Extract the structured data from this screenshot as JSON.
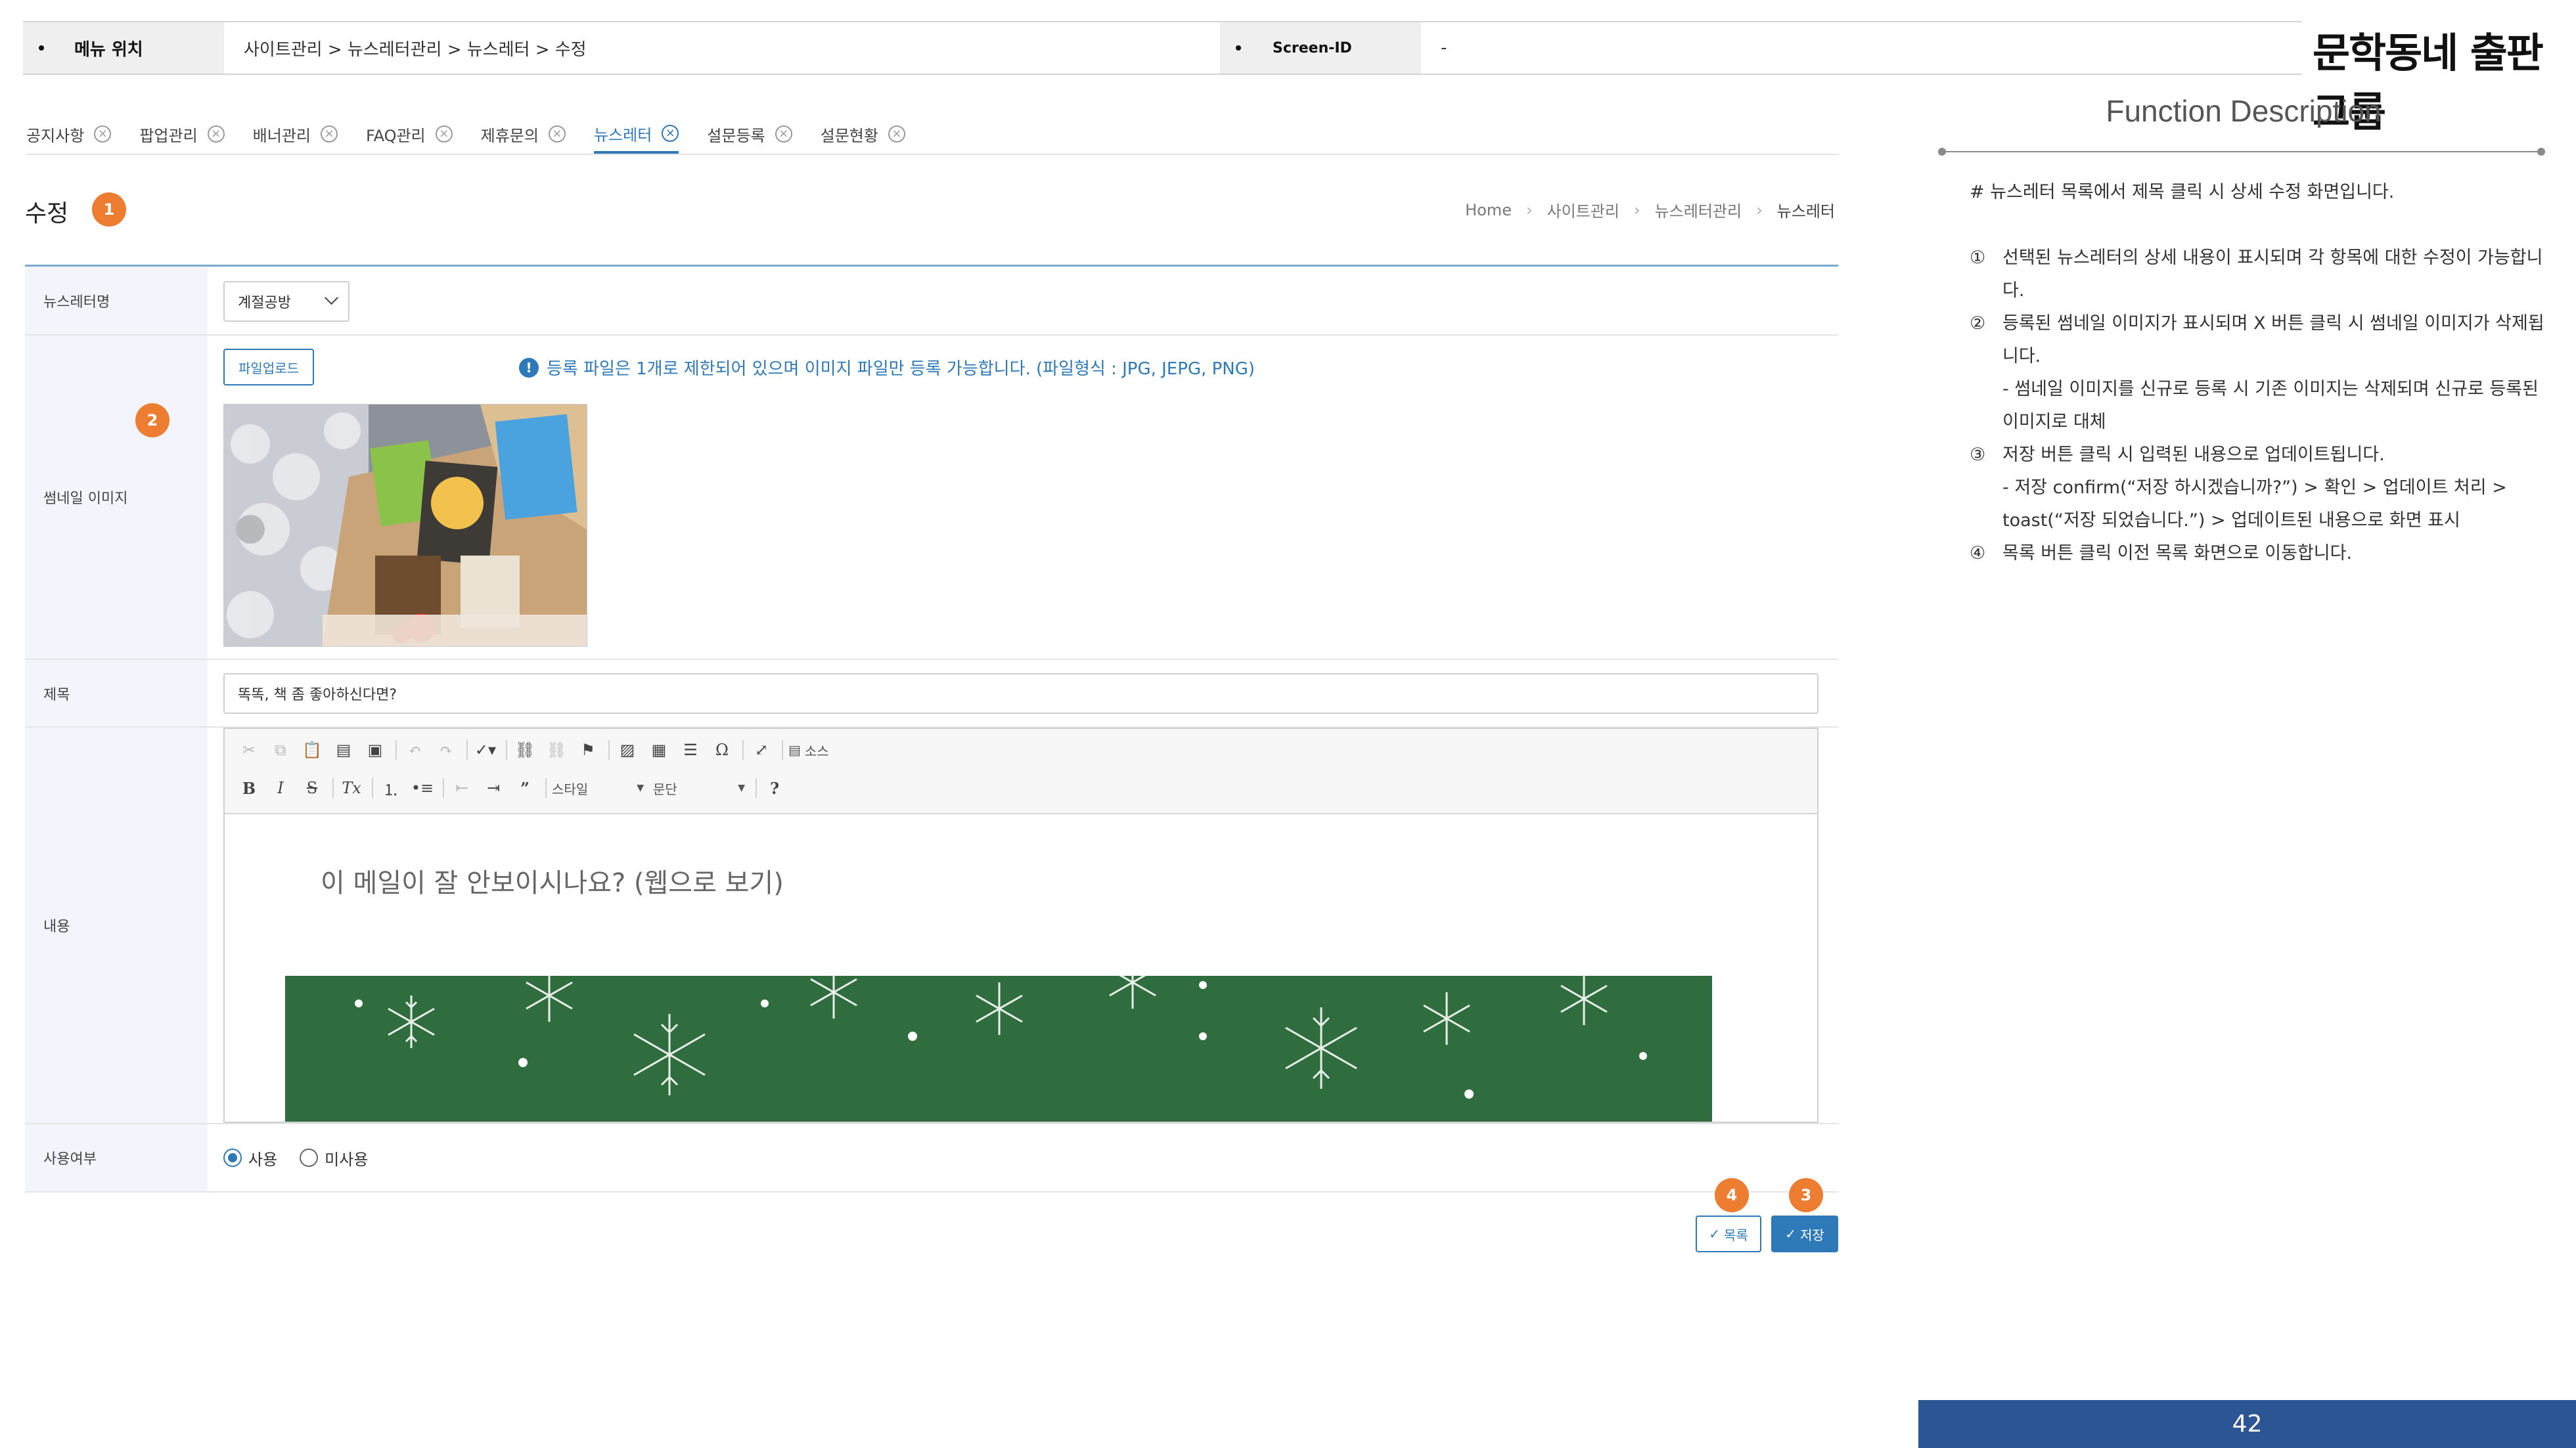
{
  "header": {
    "menu_label": "메뉴 위치",
    "menu_value": "사이트관리 > 뉴스레터관리 > 뉴스레터 > 수정",
    "screen_label": "Screen-ID",
    "screen_value": "-",
    "logo": "문학동네 출판그룹"
  },
  "tabs": [
    {
      "label": "공지사항"
    },
    {
      "label": "팝업관리"
    },
    {
      "label": "배너관리"
    },
    {
      "label": "FAQ관리"
    },
    {
      "label": "제휴문의"
    },
    {
      "label": "뉴스레터",
      "active": true
    },
    {
      "label": "설문등록"
    },
    {
      "label": "설문현황"
    }
  ],
  "page": {
    "title": "수정",
    "breadcrumb": [
      "Home",
      "사이트관리",
      "뉴스레터관리",
      "뉴스레터"
    ]
  },
  "badges": {
    "b1": "1",
    "b2": "2",
    "b3": "3",
    "b4": "4"
  },
  "form": {
    "newsletter": {
      "label": "뉴스레터명",
      "value": "계절공방"
    },
    "thumbnail": {
      "label": "썸네일 이미지",
      "upload_label": "파일업로드",
      "info": "등록 파일은 1개로 제한되어 있으며 이미지 파일만 등록 가능합니다. (파일형식 : JPG, JEPG, PNG)"
    },
    "subject": {
      "label": "제목",
      "value": "똑똑, 책 좀 좋아하신다면?"
    },
    "content": {
      "label": "내용",
      "toolbar_source": "소스",
      "toolbar_style": "스타일",
      "toolbar_paragraph": "문단",
      "body_text": "이 메일이 잘 안보이시나요? (웹으로 보기)"
    },
    "use": {
      "label": "사용여부",
      "options": [
        "사용",
        "미사용"
      ],
      "selected": "사용"
    }
  },
  "buttons": {
    "list": "목록",
    "save": "저장"
  },
  "function_description": {
    "title": "Function Description",
    "intro": "# 뉴스레터 목록에서 제목 클릭 시 상세 수정 화면입니다.",
    "items": [
      {
        "num": "①",
        "text": "선택된 뉴스레터의 상세 내용이 표시되며 각 항목에 대한 수정이 가능합니다.",
        "subs": []
      },
      {
        "num": "②",
        "text": "등록된 썸네일 이미지가 표시되며 X 버튼 클릭 시 썸네일 이미지가 삭제됩니다.",
        "subs": [
          "- 썸네일 이미지를 신규로 등록 시 기존 이미지는 삭제되며 신규로 등록된 이미지로 대체"
        ]
      },
      {
        "num": "③",
        "text": "저장 버튼 클릭 시 입력된 내용으로 업데이트됩니다.",
        "subs": [
          "- 저장 confirm(“저장 하시겠습니까?”) > 확인 > 업데이트 처리 > toast(“저장 되었습니다.”) > 업데이트된 내용으로 화면 표시"
        ]
      },
      {
        "num": "④",
        "text": "목록 버튼 클릭 이전 목록 화면으로 이동합니다.",
        "subs": []
      }
    ]
  },
  "page_number": "42",
  "colors": {
    "accent": "#2e79b8",
    "badge": "#ed7d31",
    "label_bg": "#f3f4fc",
    "footer_bar": "#2c5593",
    "banner_green": "#2f6d3f"
  }
}
